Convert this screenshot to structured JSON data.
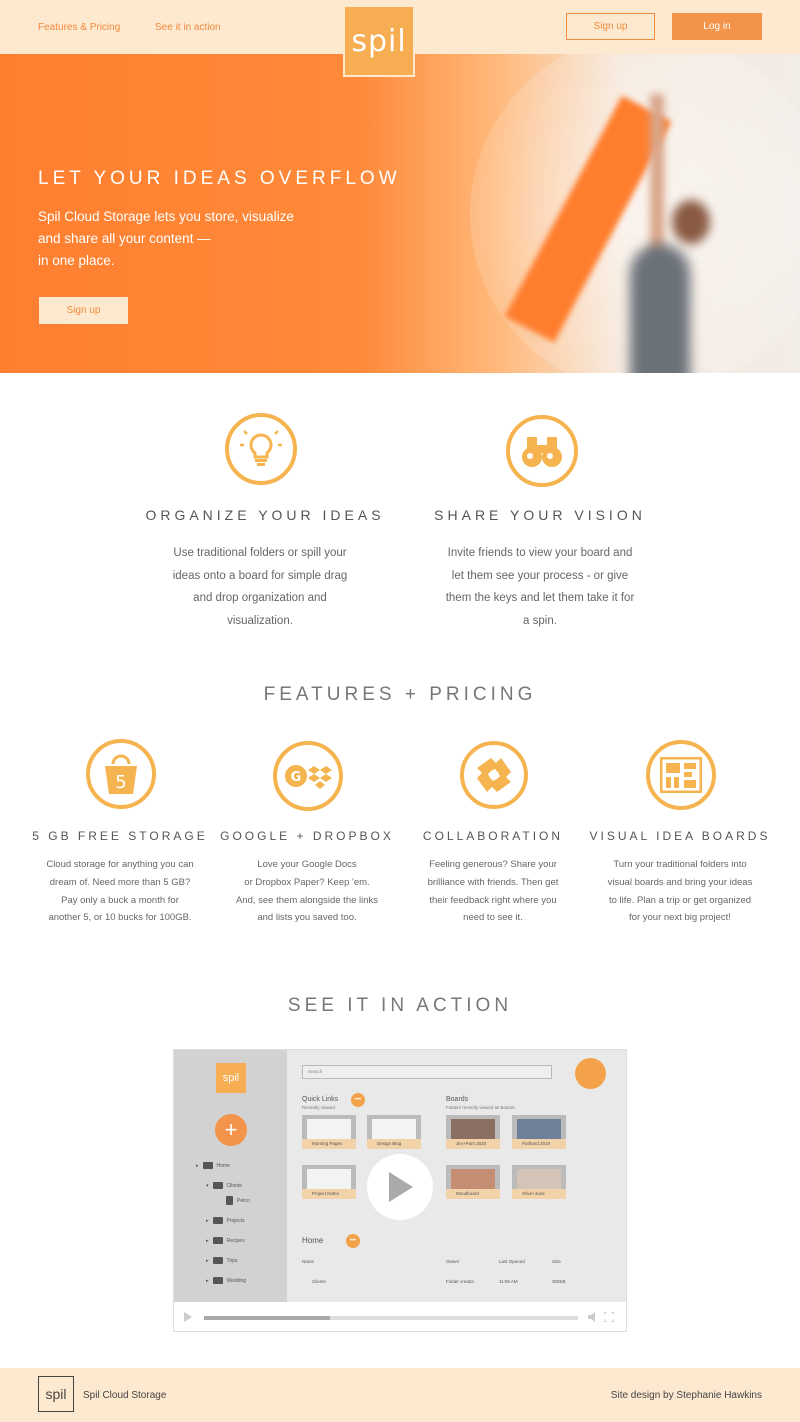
{
  "nav": {
    "link1": "Features & Pricing",
    "link2": "See it in action",
    "logo": "spil",
    "signup": "Sign up",
    "login": "Log in"
  },
  "hero": {
    "title": "LET YOUR IDEAS OVERFLOW",
    "line1": "Spil Cloud Storage lets you store, visualize",
    "line2": "and share all your content —",
    "line3": "in one place.",
    "button": "Sign up"
  },
  "intro": [
    {
      "icon": "lightbulb-icon",
      "title": "ORGANIZE YOUR IDEAS",
      "lines": [
        "Use traditional folders or spill your",
        "ideas onto a board for simple drag",
        "and drop organization and",
        "visualization."
      ]
    },
    {
      "icon": "binoculars-icon",
      "title": "SHARE YOUR VISION",
      "lines": [
        "Invite friends to view your board and",
        "let them see your process - or give",
        "them the keys and let them take it for",
        "a spin."
      ]
    }
  ],
  "features_title": "FEATURES + PRICING",
  "features": [
    {
      "icon": "bucket-icon",
      "icon_text": "5",
      "title": "5 GB FREE STORAGE",
      "lines": [
        "Cloud storage for anything you can",
        "dream of. Need more than 5 GB?",
        "Pay only a buck a month for",
        "another 5, or 10 bucks for 100GB."
      ]
    },
    {
      "icon": "google-dropbox-icon",
      "icon_text": "G",
      "title": "GOOGLE + DROPBOX",
      "lines": [
        "Love your Google Docs",
        "or Dropbox Paper? Keep 'em.",
        "And, see them alongside the links",
        "and lists you saved too."
      ]
    },
    {
      "icon": "handshake-icon",
      "icon_text": "",
      "title": "COLLABORATION",
      "lines": [
        "Feeling generous? Share your",
        "brilliance with friends. Then get",
        "their feedback right where you",
        "need to see it."
      ]
    },
    {
      "icon": "board-icon",
      "icon_text": "",
      "title": "VISUAL IDEA BOARDS",
      "lines": [
        "Turn your traditional folders into",
        "visual boards and bring your ideas",
        "to life. Plan a trip or get organized",
        "for your next big project!"
      ]
    }
  ],
  "action_title": "SEE IT IN ACTION",
  "app": {
    "logo": "spil",
    "search": "Search",
    "quick_links": "Quick Links",
    "quick_sub": "Recently viewed",
    "boards": "Boards",
    "boards_sub": "Folders recently viewed as Boards",
    "tree": [
      "Home",
      "Clients",
      "Petco",
      "Projects",
      "Recipes",
      "Trips",
      "Wedding"
    ],
    "cards_quick": [
      "Morning Pages",
      "Design Blog",
      "Project Notes"
    ],
    "cards_boards": [
      "Jim+Pam 2020",
      "Portland 2019",
      "Moodboard",
      "Olive+June"
    ],
    "home_label": "Home",
    "cols": [
      "Name",
      "Owner",
      "Last Opened",
      "Size"
    ],
    "row": [
      "Clients",
      "Folder creator",
      "11:06 AM",
      "300KB"
    ]
  },
  "footer": {
    "logo": "spil",
    "left": "Spil Cloud Storage",
    "right": "Site design by Stephanie Hawkins"
  },
  "colors": {
    "accent": "#f3944a",
    "icon": "#f5b450",
    "nav_bg": "#fde9d0"
  }
}
